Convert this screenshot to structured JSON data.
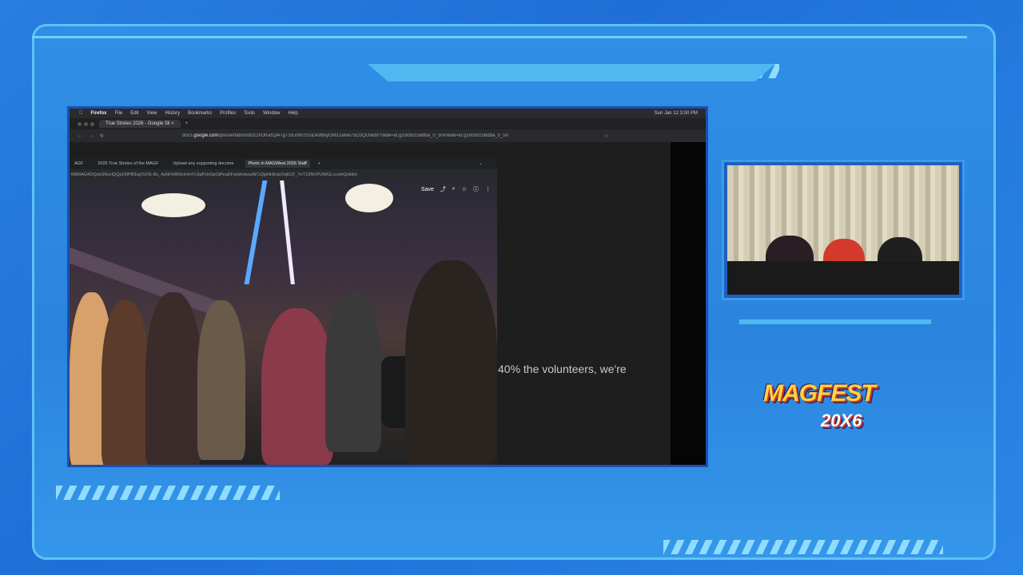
{
  "browser": {
    "menubar": {
      "app": "Firefox",
      "items": [
        "File",
        "Edit",
        "View",
        "History",
        "Bookmarks",
        "Profiles",
        "Tools",
        "Window",
        "Help"
      ],
      "clock": "Sun Jan 12 3:00 PM"
    },
    "tab_title": "True Stories 2026 - Google Sli",
    "url_prefix": "docs.",
    "url_host": "google.com",
    "url_rest": "/presentation/d/1OXDKaf1p47gTSExWUSSiDe9bxyGM12ahw75O2QU/edit?slide=id.g10cbcc58dba_0_50#slide=id.g10cbcc58dba_0_50"
  },
  "inner_browser": {
    "tabs": [
      "AGF",
      "2026 True Stories of the MAGF",
      "Upload any supporting docume",
      "Photo in MAGWest 2026 Staff"
    ],
    "url": "MM9AG4OQzbSNcHQQpO0PB3xgTsI7E-Bx_4uNFHWGnHmYL6pPchOpOjPeaDFw/photos/AF1QipNHEdzOq6CF_YvT1SNVPUWGLccsmQv9dm",
    "photo_toolbar": {
      "save": "Save"
    }
  },
  "slide": {
    "caption": "40% the volunteers, we're"
  },
  "logo": {
    "main": "MAGFEST",
    "sub": "20X6"
  },
  "colors": {
    "frame_blue": "#2a84de",
    "accent_light": "#6dd0ff",
    "logo_yellow": "#ffd23f"
  }
}
